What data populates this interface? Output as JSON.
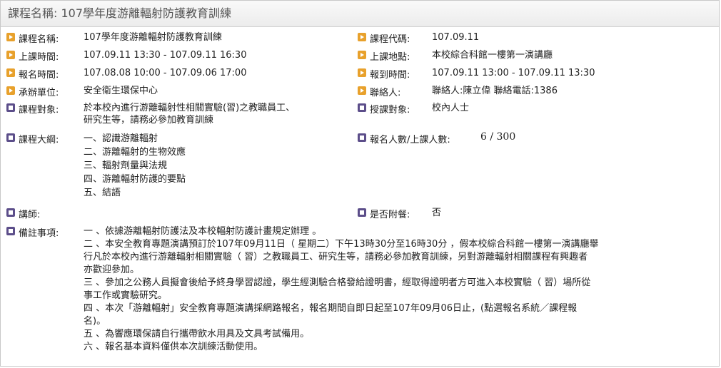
{
  "header": {
    "title": "課程名稱: 107學年度游離輻射防護教育訓練"
  },
  "left": {
    "course_name": {
      "label": "課程名稱:",
      "value": "107學年度游離輻射防護教育訓練"
    },
    "class_time": {
      "label": "上課時間:",
      "value": "107.09.11 13:30 - 107.09.11 16:30"
    },
    "signup_time": {
      "label": "報名時間:",
      "value": "107.08.08 10:00 - 107.09.06 17:00"
    },
    "organizer": {
      "label": "承辦單位:",
      "value": "安全衛生環保中心"
    },
    "target": {
      "label": "課程對象:",
      "line1": "於本校內進行游離輻射性相關實驗(習)之教職員工、",
      "line2": "研究生等，請務必參加教育訓練"
    },
    "outline": {
      "label": "課程大綱:",
      "items": [
        "一、認識游離輻射",
        "二、游離輻射的生物效應",
        "三、輻射劑量與法規",
        "四、游離輻射防護的要點",
        "五、結語"
      ]
    },
    "lecturer": {
      "label": "講師:",
      "value": ""
    },
    "notes": {
      "label": "備註事項:",
      "lines": [
        "一 、依據游離輻射防護法及本校輻射防護計畫規定辦理 。",
        "二 、本安全教育專題演講預訂於107年09月11日（ 星期二）下午13時30分至16時30分 ，假本校綜合科館一樓第一演講廳舉",
        "行凡於本校內進行游離輻射相關實驗（ 習）之教職員工、研究生等，請務必參加教育訓練，另對游離輻射相關課程有興趣者",
        "亦歡迎參加。",
        "三 、參加之公務人員擬會後給予終身學習認證，學生經測驗合格發給證明書，經取得證明者方可進入本校實驗（ 習）場所從",
        "事工作或實驗研究。",
        "四 、本次「游離輻射」安全教育專題演講採網路報名，報名期間自即日起至107年09月06日止，(點選報名系統／課程報",
        "名)。",
        "五 、為響應環保請自行攜帶飲水用具及文具考試備用。",
        "六 、報名基本資料僅供本次訓練活動使用。"
      ]
    }
  },
  "right": {
    "course_code": {
      "label": "課程代碼:",
      "value": "107.09.11"
    },
    "location": {
      "label": "上課地點:",
      "value": "本校綜合科館一樓第一演講廳"
    },
    "checkin_time": {
      "label": "報到時間:",
      "value": "107.09.11 13:00 - 107.09.11 13:30"
    },
    "contact": {
      "label": "聯絡人:",
      "value": "聯絡人:陳立偉 聯絡電話:1386"
    },
    "audience": {
      "label": "授課對象:",
      "value": "校內人士"
    },
    "enrollment": {
      "label": "報名人數/上課人數:",
      "value": "6 / 300"
    },
    "meal": {
      "label": "是否附餐:",
      "value": "否"
    }
  },
  "colors": {
    "arrow_icon": "#e8a12c",
    "square_icon": "#5c4e8a",
    "header_bg": "#ececec"
  }
}
